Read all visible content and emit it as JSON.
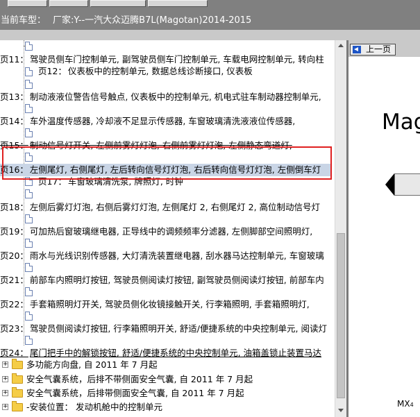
{
  "header": {
    "vehicle_label": "当前车型：",
    "vehicle_value": "厂家:Y--一汽大众迈腾B7L(Magotan)2014-2015"
  },
  "tree": {
    "page_rows": [
      {
        "page": "页11：",
        "text": "驾驶员侧车门控制单元, 副驾驶员侧车门控制单元, 车载电网控制单元, 转向柱"
      },
      {
        "page": "页13：",
        "text": "制动液液位警告信号触点, 仪表板中的控制单元, 机电式驻车制动器控制单元,"
      },
      {
        "page": "页14：",
        "text": "车外温度传感器, 冷却液不足显示传感器, 车窗玻璃清洗液液位传感器,"
      },
      {
        "page": "页15：",
        "text": "制动信号灯开关, 左侧前雾灯灯泡, 右侧前雾灯灯泡, 左侧静态弯道灯,"
      },
      {
        "page": "页16：",
        "text": "左侧尾灯, 右侧尾灯, 左后转向信号灯灯泡, 右后转向信号灯灯泡, 左侧倒车灯"
      },
      {
        "page": "页18：",
        "text": "左侧后雾灯灯泡, 右侧后雾灯灯泡, 左侧尾灯 2, 右侧尾灯 2, 高位制动信号灯"
      },
      {
        "page": "页19：",
        "text": "可加热后窗玻璃继电器, 正导线中的调频频率分滤器, 左侧脚部空间照明灯,"
      },
      {
        "page": "页20：",
        "text": "雨水与光线识别传感器, 大灯清洗装置继电器, 刮水器马达控制单元, 车窗玻璃"
      },
      {
        "page": "页21：",
        "text": "前部车内照明灯按钮, 驾驶员侧阅读灯按钮, 副驾驶员侧阅读灯按钮, 前部车内"
      },
      {
        "page": "页22：",
        "text": "手套箱照明灯开关, 驾驶员侧化妆镜接触开关, 行李箱照明, 手套箱照明灯,"
      },
      {
        "page": "页23：",
        "text": "驾驶员侧阅读灯按钮, 行李箱照明开关, 舒适/便捷系统的中央控制单元, 阅读灯"
      },
      {
        "page": "页24：",
        "text": "尾门把手中的解锁按钮, 舒适/便捷系统的中央控制单元, 油箱盖锁止装置马达"
      }
    ],
    "sub_rows": [
      {
        "page": "页12：",
        "text": "仪表板中的控制单元, 数据总线诊断接口, 仪表板"
      },
      {
        "page": "页17：",
        "text": "车窗玻璃清洗泵, 牌照灯, 时钟"
      }
    ],
    "folders": [
      {
        "expander": "+",
        "text": "多功能方向盘, 自 2011 年 7 月起"
      },
      {
        "expander": "+",
        "text": "安全气囊系统，后排不带侧面安全气囊, 自 2011 年 7 月起"
      },
      {
        "expander": "+",
        "text": "安全气囊系统，后排带侧面安全气囊, 自 2011 年 7 月起"
      },
      {
        "expander": "+",
        "text": "-安装位置： 发动机舱中的控制单元"
      }
    ]
  },
  "right_panel": {
    "prev_button_label": "上一页",
    "model_title": "Mag",
    "code_main": "MX",
    "code_sub": "4"
  },
  "colors": {
    "toolbar_bg": "#808080",
    "selection_bg": "#c9d5e6",
    "highlight_border": "#e02020",
    "folder": "#f5cd47",
    "link_blue": "#1d55c6"
  }
}
